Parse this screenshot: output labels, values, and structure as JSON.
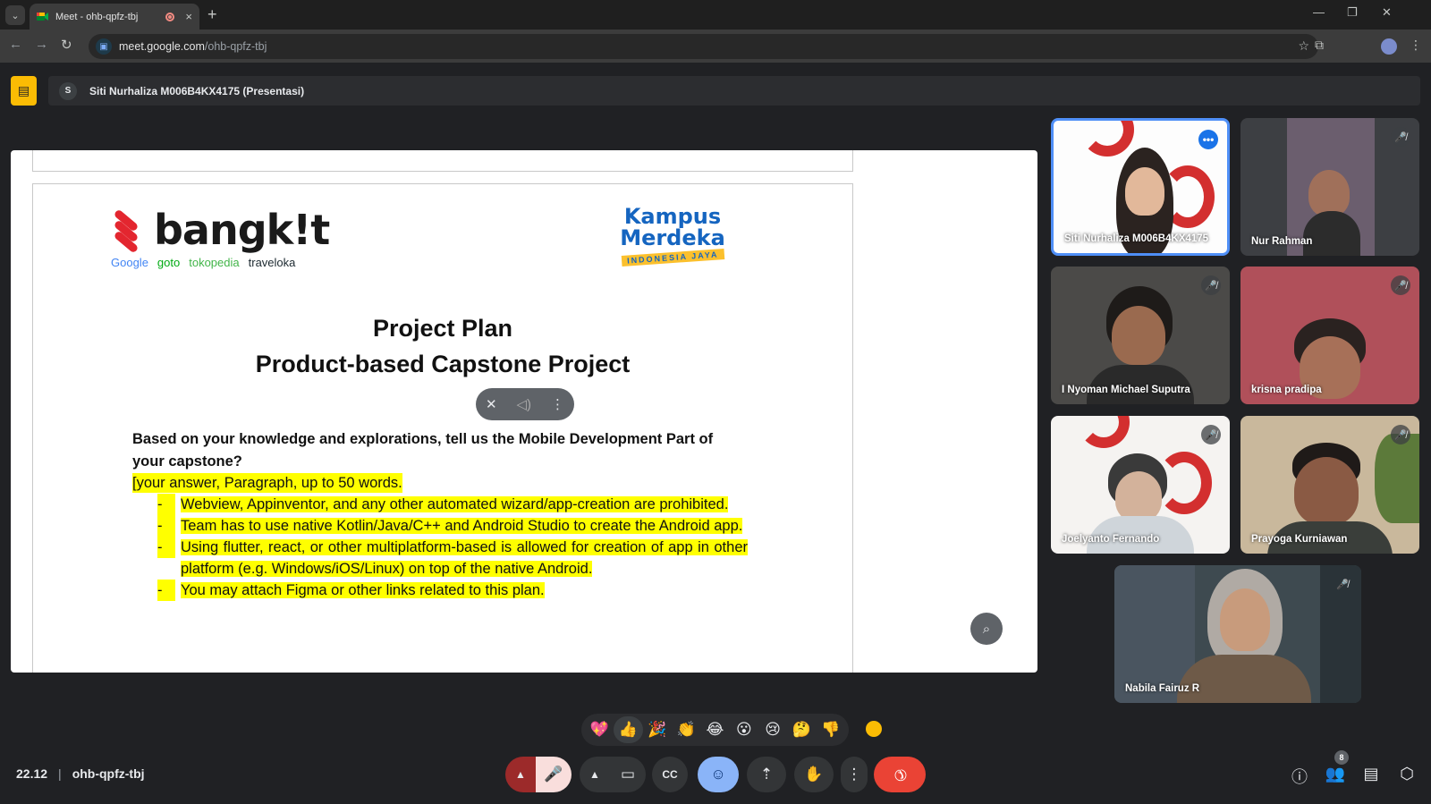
{
  "browser": {
    "tab_title": "Meet - ohb-qpfz-tbj",
    "tab_close": "×",
    "new_tab": "+",
    "tab_menu": "⌄",
    "url_host": "meet.google.com",
    "url_path": "/ohb-qpfz-tbj",
    "window_min": "—",
    "window_restore": "❐",
    "window_close": "✕"
  },
  "meet": {
    "presenter_initial": "S",
    "presenter_label": "Siti Nurhaliza M006B4KX4175 (Presentasi)"
  },
  "slide": {
    "brand": "bangk!t",
    "partners": [
      "Google",
      "goto",
      "tokopedia",
      "traveloka"
    ],
    "kampus_line1": "Kampus",
    "kampus_line2": "Merdeka",
    "kampus_line3": "INDONESIA JAYA",
    "title_line1": "Project Plan",
    "title_line2": "Product-based Capstone Project",
    "question": "Based on your knowledge and explorations, tell us the Mobile Development Part of your capstone?",
    "answer_prompt": "[your answer, Paragraph, up to 50 words.",
    "bullets": [
      "Webview, Appinventor, and any other automated wizard/app-creation are prohibited.",
      "Team has to use native Kotlin/Java/C++ and Android Studio to create the Android app.",
      "Using flutter, react, or other multiplatform-based is allowed for creation of app in other platform (e.g. Windows/iOS/Linux) on top of the native Android.",
      "You may attach Figma or other links related to this plan."
    ]
  },
  "participants": [
    {
      "name": "Siti Nurhaliza M006B4KX4175",
      "status": "more"
    },
    {
      "name": "Nur Rahman",
      "status": "muted"
    },
    {
      "name": "I Nyoman Michael Suputra",
      "status": "muted"
    },
    {
      "name": "krisna pradipa",
      "status": "muted"
    },
    {
      "name": "Joelyanto Fernando",
      "status": "muted"
    },
    {
      "name": "Prayoga Kurniawan",
      "status": "muted"
    },
    {
      "name": "Nabila Fairuz R",
      "status": "muted"
    }
  ],
  "reactions": [
    "💖",
    "👍",
    "🎉",
    "👏",
    "😂",
    "😮",
    "😢",
    "🤔",
    "👎"
  ],
  "footer": {
    "time": "22.12",
    "separator": "|",
    "meeting_code": "ohb-qpfz-tbj",
    "participant_count": "8"
  },
  "colors": {
    "background": "#202124",
    "end_call": "#ea4335",
    "highlight": "#ffff00",
    "accent": "#8ab4f8"
  }
}
